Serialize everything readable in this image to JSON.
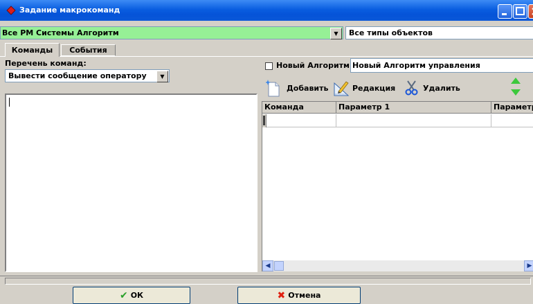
{
  "window": {
    "title": "Задание макрокоманд",
    "icon": "app-icon",
    "controls": [
      "minimize-icon",
      "maximize-icon",
      "close-icon"
    ],
    "title_bar_color": "#0a5ee0"
  },
  "top": {
    "station_combo": {
      "value": "Все РМ Системы Алгоритм",
      "background": "#96f096"
    },
    "types_combo": {
      "value": "Все типы объектов"
    }
  },
  "tabs": [
    {
      "label": "Команды",
      "selected": true
    },
    {
      "label": "События",
      "selected": false
    }
  ],
  "left": {
    "cmd_list_label": "Перечень команд:",
    "cmd_combo_value": "Вывести сообщение оператору",
    "editor_text": ""
  },
  "right": {
    "new_algo_label": "Новый Алгоритм",
    "new_algo_checked": false,
    "algo_name": "Новый Алгоритм управления",
    "toolbar": {
      "add_label": "Добавить",
      "edit_label": "Редакция",
      "delete_label": "Удалить"
    },
    "grid": {
      "columns": [
        "Команда",
        "Параметр 1",
        "Параметр"
      ],
      "rows": [
        [
          "",
          "",
          ""
        ]
      ]
    }
  },
  "buttons": {
    "ok_label": "ОК",
    "cancel_label": "Отмена"
  },
  "colors": {
    "ok_check": "#2aa02a",
    "cancel_x": "#e02010",
    "nav_arrows": "#3cc83c"
  }
}
